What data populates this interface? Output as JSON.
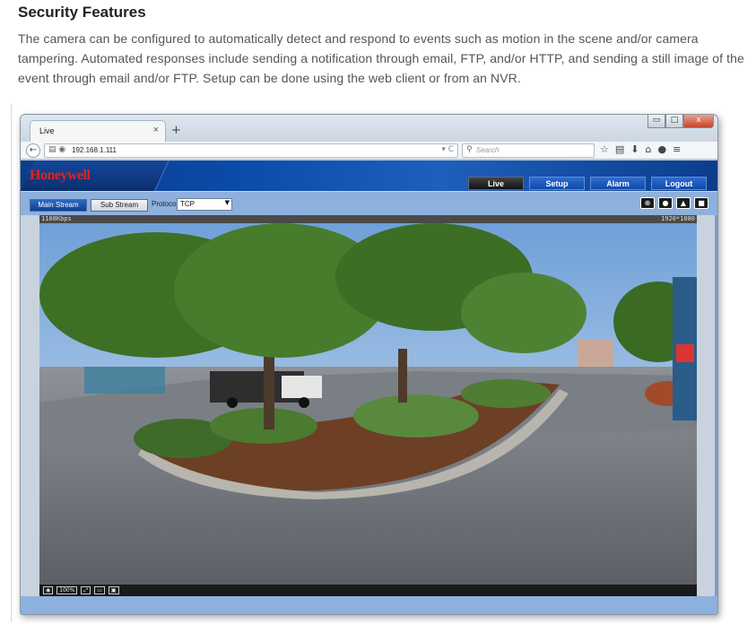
{
  "doc": {
    "title": "Security Features",
    "body": "The camera can be configured to automatically detect and respond to events such as motion in the scene and/or camera tampering. Automated responses include sending a notification through email, FTP, and/or HTTP, and sending a still image of the event through email and/or FTP. Setup can be done using the web client or from an NVR."
  },
  "browser": {
    "tab_label": "Live",
    "tab_close": "×",
    "new_tab": "+",
    "url": "192.168.1.111",
    "search_placeholder": "Search",
    "window_buttons": [
      "▭",
      "□",
      "x"
    ]
  },
  "app": {
    "logo": "Honeywell",
    "menu": [
      {
        "label": "Live",
        "active": true
      },
      {
        "label": "Setup",
        "active": false
      },
      {
        "label": "Alarm",
        "active": false
      },
      {
        "label": "Logout",
        "active": false
      }
    ],
    "main_stream": "Main Stream",
    "sub_stream": "Sub Stream",
    "protocol_label": "Protocol",
    "protocol_value": "TCP",
    "bitrate": "1108Kbps",
    "resolution": "1920*1080",
    "zoom_label": "100%"
  },
  "colors": {
    "banner": "#0a4aa8",
    "logo": "#e0231d",
    "controls_bg": "#8eb0dc"
  }
}
